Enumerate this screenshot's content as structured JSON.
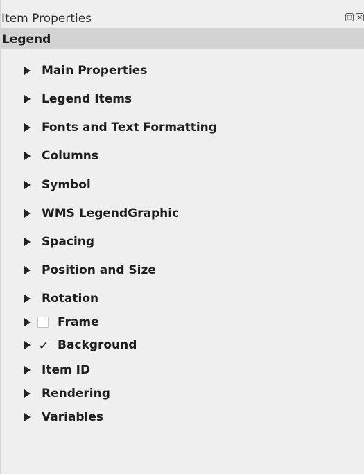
{
  "panel": {
    "title": "Item Properties",
    "header": "Legend"
  },
  "sections": [
    {
      "label": "Main Properties"
    },
    {
      "label": "Legend Items"
    },
    {
      "label": "Fonts and Text Formatting"
    },
    {
      "label": "Columns"
    },
    {
      "label": "Symbol"
    },
    {
      "label": "WMS LegendGraphic"
    },
    {
      "label": "Spacing"
    },
    {
      "label": "Position and Size"
    },
    {
      "label": "Rotation"
    },
    {
      "label": "Frame",
      "checkbox": true,
      "checked": false
    },
    {
      "label": "Background",
      "checkbox": true,
      "checked": true
    },
    {
      "label": "Item ID"
    },
    {
      "label": "Rendering"
    },
    {
      "label": "Variables"
    }
  ],
  "icons": {
    "float": "float-icon",
    "close": "close-icon",
    "expand": "expand-triangle-icon",
    "check": "checkmark-icon"
  }
}
